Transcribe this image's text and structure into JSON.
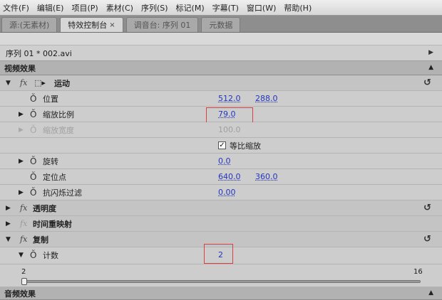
{
  "menu": [
    "文件(F)",
    "编辑(E)",
    "项目(P)",
    "素材(C)",
    "序列(S)",
    "标记(M)",
    "字幕(T)",
    "窗口(W)",
    "帮助(H)"
  ],
  "tabs": [
    {
      "label": "源:(无素材)"
    },
    {
      "label": "特效控制台",
      "close": "×"
    },
    {
      "label": "调音台: 序列 01"
    },
    {
      "label": "元数据"
    }
  ],
  "sequence_label": "序列 01 * 002.avi",
  "video_effects_header": "视频效果",
  "audio_effects_header": "音频效果",
  "motion": {
    "name": "运动",
    "position_label": "位置",
    "position_x": "512.0",
    "position_y": "288.0",
    "scale_label": "缩放比例",
    "scale_value": "79.0",
    "scale_width_label": "缩放宽度",
    "scale_width_value": "100.0",
    "uniform_scale_label": "等比缩放",
    "uniform_scale_checked": true,
    "rotation_label": "旋转",
    "rotation_value": "0.0",
    "anchor_label": "定位点",
    "anchor_x": "640.0",
    "anchor_y": "360.0",
    "antiflicker_label": "抗闪烁过滤",
    "antiflicker_value": "0.00"
  },
  "opacity": {
    "name": "透明度"
  },
  "time_remap": {
    "name": "时间重映射"
  },
  "replicate": {
    "name": "复制",
    "count_label": "计数",
    "count_value": "2",
    "slider_min": "2",
    "slider_max": "16"
  },
  "icons": {
    "triangle_right": "▶",
    "triangle_down": "▼",
    "triangle_up": "▲",
    "fx": "fx",
    "stopwatch": "Ŏ",
    "reset": "↺",
    "check": "✓",
    "motion_box": "⬚▸"
  },
  "colors": {
    "value_link": "#2436b8",
    "highlight": "#d94040"
  }
}
